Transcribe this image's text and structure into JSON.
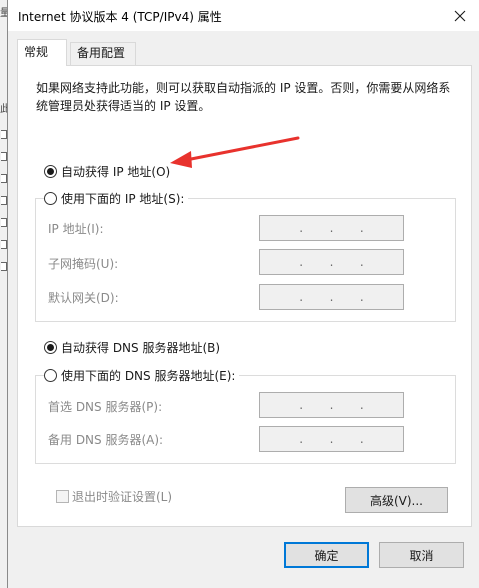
{
  "window": {
    "title": "Internet 协议版本 4 (TCP/IPv4) 属性"
  },
  "tabs": [
    {
      "label": "常规",
      "active": true
    },
    {
      "label": "备用配置",
      "active": false
    }
  ],
  "description": "如果网络支持此功能，则可以获取自动指派的 IP 设置。否则，你需要从网络系统管理员处获得适当的 IP 设置。",
  "ip_section": {
    "auto_label": "自动获得 IP 地址(O)",
    "manual_label": "使用下面的 IP 地址(S):",
    "selected": "auto",
    "fields": [
      {
        "label": "IP 地址(I):",
        "value": ". . ."
      },
      {
        "label": "子网掩码(U):",
        "value": ". . ."
      },
      {
        "label": "默认网关(D):",
        "value": ". . ."
      }
    ]
  },
  "dns_section": {
    "auto_label": "自动获得 DNS 服务器地址(B)",
    "manual_label": "使用下面的 DNS 服务器地址(E):",
    "selected": "auto",
    "fields": [
      {
        "label": "首选 DNS 服务器(P):",
        "value": ". . ."
      },
      {
        "label": "备用 DNS 服务器(A):",
        "value": ". . ."
      }
    ]
  },
  "validate_on_exit": {
    "label": "退出时验证设置(L)",
    "checked": false
  },
  "buttons": {
    "advanced": "高级(V)...",
    "ok": "确定",
    "cancel": "取消"
  },
  "colors": {
    "dialog_bg": "#f0f0f0",
    "panel_bg": "#ffffff",
    "default_button_border": "#0078d7",
    "annotation_arrow": "#e8322d",
    "disabled_text": "#8a8a8a"
  },
  "icons": {
    "close": "close-icon",
    "annotation": "red-arrow-annotation"
  }
}
